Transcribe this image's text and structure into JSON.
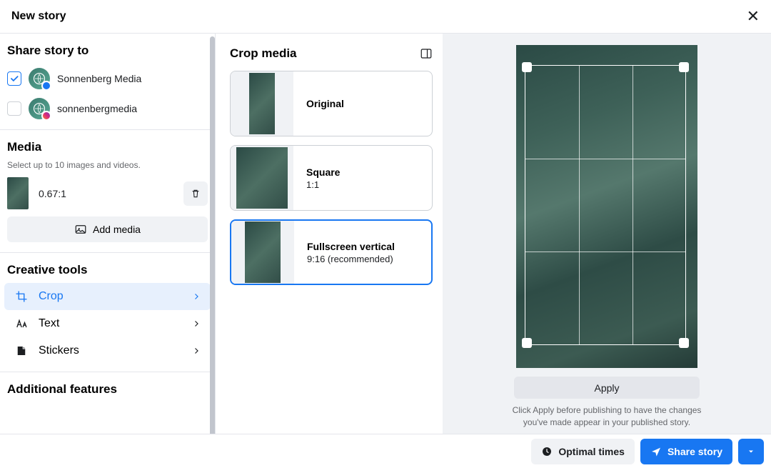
{
  "header": {
    "title": "New story"
  },
  "share": {
    "heading": "Share story to",
    "accounts": [
      {
        "name": "Sonnenberg Media",
        "checked": true,
        "platform": "facebook"
      },
      {
        "name": "sonnenbergmedia",
        "checked": false,
        "platform": "instagram"
      }
    ]
  },
  "media": {
    "heading": "Media",
    "subtext": "Select up to 10 images and videos.",
    "item_ratio": "0.67:1",
    "add_label": "Add media"
  },
  "tools": {
    "heading": "Creative tools",
    "crop": "Crop",
    "text": "Text",
    "stickers": "Stickers"
  },
  "additional": {
    "heading": "Additional features"
  },
  "crop": {
    "heading": "Crop media",
    "options": [
      {
        "name": "Original",
        "ratio": ""
      },
      {
        "name": "Square",
        "ratio": "1:1"
      },
      {
        "name": "Fullscreen vertical",
        "ratio": "9:16 (recommended)"
      }
    ]
  },
  "preview": {
    "apply": "Apply",
    "hint": "Click Apply before publishing to have the changes you've made appear in your published story."
  },
  "footer": {
    "optimal": "Optimal times",
    "share": "Share story"
  }
}
